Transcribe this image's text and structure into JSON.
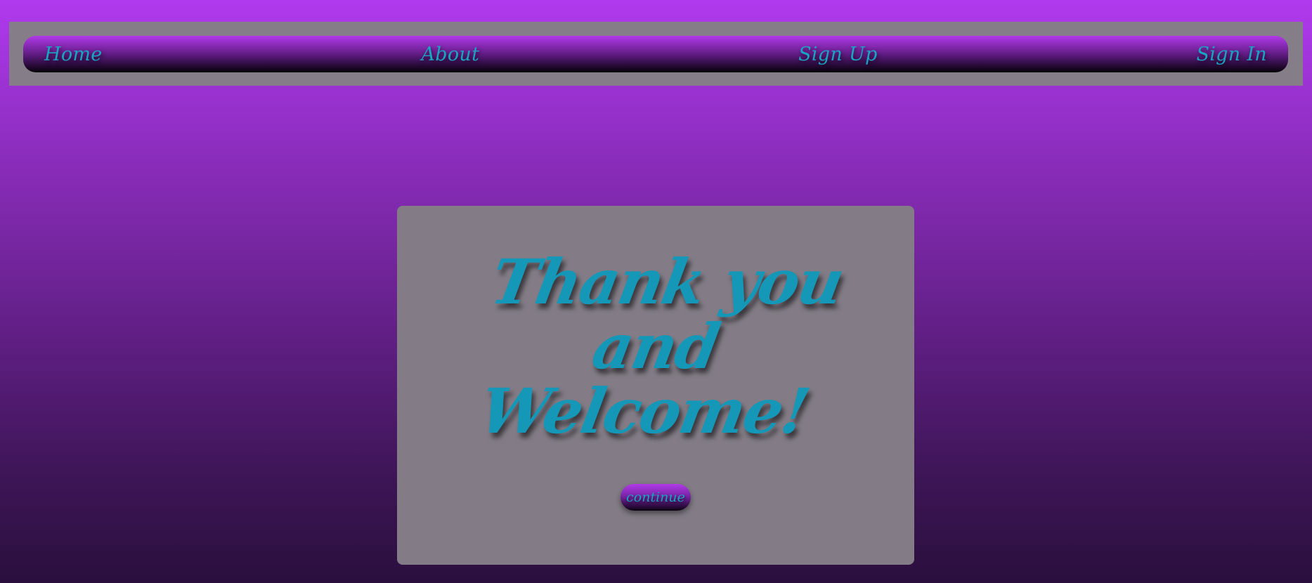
{
  "nav": {
    "items": [
      {
        "label": "Home"
      },
      {
        "label": "About"
      },
      {
        "label": "Sign Up"
      },
      {
        "label": "Sign In"
      }
    ]
  },
  "card": {
    "headline_lines": [
      "Thank you",
      "and",
      "Welcome!"
    ],
    "continue_label": "continue"
  },
  "colors": {
    "accent_text": "#1aa4c4",
    "panel": "#837c86",
    "gradient_top": "#b03aee",
    "gradient_bottom": "#2a0f3d"
  }
}
